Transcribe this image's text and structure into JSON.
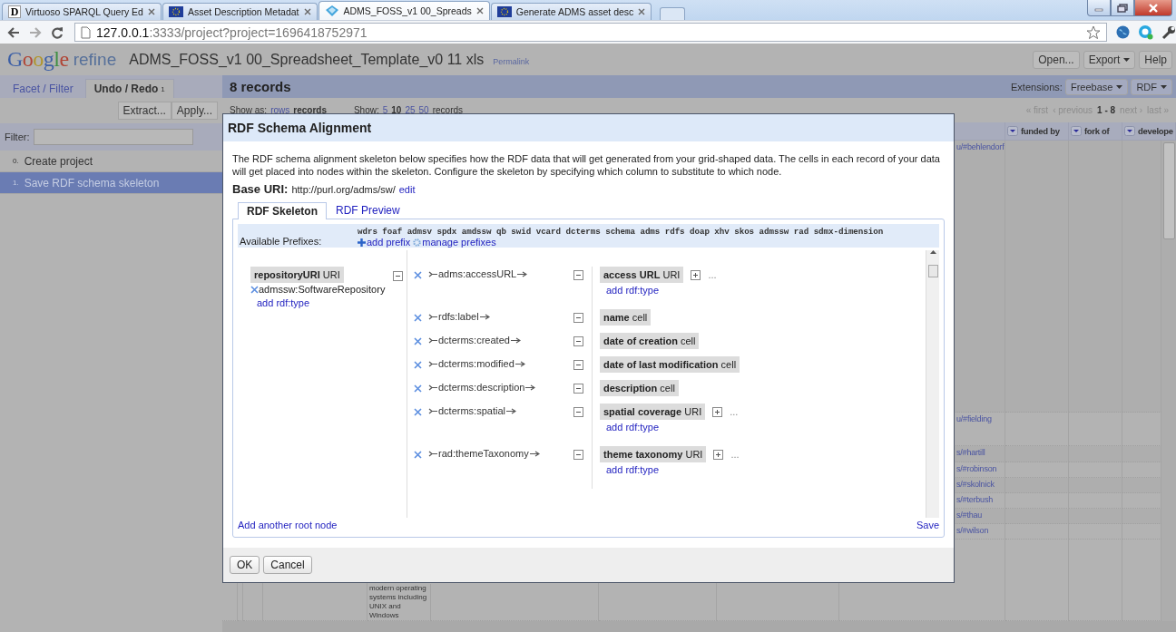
{
  "browser": {
    "tabs": [
      {
        "kind": "letter",
        "icon_text": "D",
        "title": "Virtuoso SPARQL Query Ed",
        "selected": false
      },
      {
        "kind": "flag",
        "title": "Asset Description Metadat",
        "selected": false
      },
      {
        "kind": "refine",
        "title": "ADMS_FOSS_v1 00_Spreads",
        "selected": true
      },
      {
        "kind": "flag",
        "title": "Generate ADMS asset desc",
        "selected": false
      }
    ],
    "address": {
      "host": "127.0.0.1",
      "rest": ":3333/project?project=1696418752971"
    }
  },
  "header": {
    "logo": {
      "brand": "Google",
      "product": "refine"
    },
    "project_name": "ADMS_FOSS_v1 00_Spreadsheet_Template_v0 11 xls",
    "permalink": "Permalink",
    "buttons": [
      {
        "label": "Open...",
        "menu": false
      },
      {
        "label": "Export",
        "menu": true
      },
      {
        "label": "Help",
        "menu": false
      }
    ]
  },
  "left_panel": {
    "tabs": [
      {
        "label": "Facet / Filter",
        "selected": false
      },
      {
        "label": "Undo / Redo",
        "count": "1",
        "selected": true
      }
    ],
    "buttons": [
      "Extract...",
      "Apply..."
    ],
    "filter_label": "Filter:",
    "history": [
      {
        "index": "0.",
        "label": "Create project",
        "selected": false
      },
      {
        "index": "1.",
        "label": "Save RDF schema skeleton",
        "selected": true
      }
    ]
  },
  "records": {
    "title": "8 records",
    "extensions_label": "Extensions:",
    "extension_menus": [
      "Freebase",
      "RDF"
    ],
    "show_as": {
      "label": "Show as:",
      "options": [
        {
          "label": "rows",
          "selected": false
        },
        {
          "label": "records",
          "selected": true
        }
      ]
    },
    "show": {
      "label": "Show:",
      "options": [
        {
          "label": "5",
          "selected": false
        },
        {
          "label": "10",
          "selected": true
        },
        {
          "label": "25",
          "selected": false
        },
        {
          "label": "50",
          "selected": false
        }
      ],
      "suffix": "records"
    },
    "pager": [
      {
        "label": "« first",
        "disabled": true
      },
      {
        "label": "‹ previous",
        "disabled": true
      },
      {
        "label": "1 - 8",
        "kind": "range"
      },
      {
        "label": "next ›",
        "disabled": true
      },
      {
        "label": "last »",
        "disabled": true
      }
    ]
  },
  "table": {
    "columns": [
      {
        "label": "funded by"
      },
      {
        "label": "fork of"
      },
      {
        "label": "develope"
      }
    ],
    "link_cells": [
      "u/#behlendorf",
      "u/#fielding",
      "s/#hartill",
      "s/#robinson",
      "s/#skolnick",
      "s/#terbush",
      "s/#thau",
      "s/#wilson"
    ],
    "description_cell": "modern operating systems including UNIX and Windows"
  },
  "dialog": {
    "title": "RDF Schema Alignment",
    "intro": "The RDF schema alignment skeleton below specifies how the RDF data that will get generated from your grid-shaped data. The cells in each record of your data will get placed into nodes within the skeleton. Configure the skeleton by specifying which column to substitute to which node.",
    "base_uri": {
      "label": "Base URI:",
      "value": "http://purl.org/adms/sw/",
      "edit": "edit"
    },
    "tabs": [
      {
        "label": "RDF Skeleton",
        "selected": true
      },
      {
        "label": "RDF Preview",
        "selected": false
      }
    ],
    "prefixes": {
      "label": "Available Prefixes:",
      "list": "wdrs foaf admsv spdx amdssw qb swid vcard dcterms schema adms rdfs doap xhv skos admssw rad sdmx-dimension",
      "add": "add prefix",
      "manage": "manage prefixes"
    },
    "root": {
      "label": "repositoryURI",
      "type": "URI",
      "rdf_types": [
        "admssw:SoftwareRepository"
      ],
      "add_type": "add rdf:type"
    },
    "properties": [
      {
        "property": "adms:accessURL",
        "node": {
          "label": "access URL",
          "type": "URI",
          "add_type": "add rdf:type",
          "more": "..."
        }
      },
      {
        "property": "rdfs:label",
        "node": {
          "label": "name",
          "type": "cell"
        }
      },
      {
        "property": "dcterms:created",
        "node": {
          "label": "date of creation",
          "type": "cell"
        }
      },
      {
        "property": "dcterms:modified",
        "node": {
          "label": "date of last modification",
          "type": "cell"
        }
      },
      {
        "property": "dcterms:description",
        "node": {
          "label": "description",
          "type": "cell"
        }
      },
      {
        "property": "dcterms:spatial",
        "node": {
          "label": "spatial coverage",
          "type": "URI",
          "add_type": "add rdf:type",
          "more": "..."
        }
      },
      {
        "property": "rad:themeTaxonomy",
        "node": {
          "label": "theme taxonomy",
          "type": "URI",
          "add_type": "add rdf:type",
          "more": "..."
        }
      }
    ],
    "add_root": "Add another root node",
    "save": "Save",
    "buttons": [
      "OK",
      "Cancel"
    ]
  }
}
